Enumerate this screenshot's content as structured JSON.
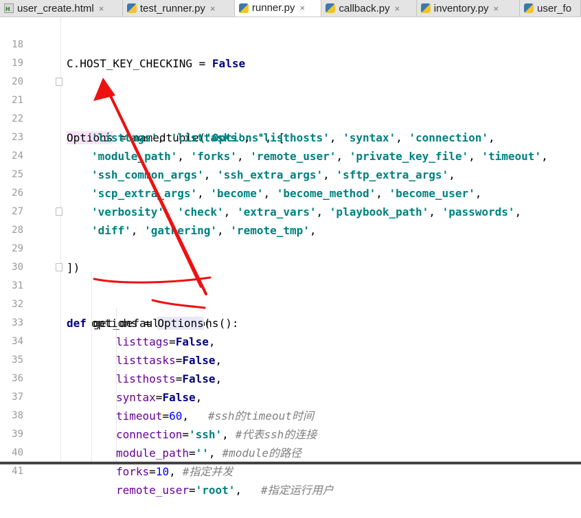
{
  "tabs": [
    {
      "label": "user_create.html",
      "icon": "html-file-icon",
      "active": false
    },
    {
      "label": "test_runner.py",
      "icon": "python-file-icon",
      "active": false
    },
    {
      "label": "runner.py",
      "icon": "python-file-icon",
      "active": true
    },
    {
      "label": "callback.py",
      "icon": "python-file-icon",
      "active": false
    },
    {
      "label": "inventory.py",
      "icon": "python-file-icon",
      "active": false
    },
    {
      "label": "user_fo",
      "icon": "python-file-icon",
      "active": false
    }
  ],
  "close_glyph": "×",
  "lines": [
    {
      "n": "18"
    },
    {
      "n": "19"
    },
    {
      "n": "20"
    },
    {
      "n": "21"
    },
    {
      "n": "22"
    },
    {
      "n": "23"
    },
    {
      "n": "24"
    },
    {
      "n": "25"
    },
    {
      "n": "26"
    },
    {
      "n": "27"
    },
    {
      "n": "28"
    },
    {
      "n": "29"
    },
    {
      "n": "30"
    },
    {
      "n": "31"
    },
    {
      "n": "32"
    },
    {
      "n": "33"
    },
    {
      "n": "34"
    },
    {
      "n": "35"
    },
    {
      "n": "36"
    },
    {
      "n": "37"
    },
    {
      "n": "38"
    },
    {
      "n": "39"
    },
    {
      "n": "40"
    },
    {
      "n": "41"
    }
  ],
  "code": {
    "l18": "C.HOST_KEY_CHECKING = ",
    "false": "False",
    "options": "Options",
    "nt_eq": " = namedtuple(",
    "nt_name": "'Options'",
    "nt_open": ", [",
    "l22": [
      "'listtags'",
      "'listtasks'",
      "'listhosts'",
      "'syntax'",
      "'connection'"
    ],
    "l23": [
      "'module_path'",
      "'forks'",
      "'remote_user'",
      "'private_key_file'",
      "'timeout'"
    ],
    "l24": [
      "'ssh_common_args'",
      "'ssh_extra_args'",
      "'sftp_extra_args'"
    ],
    "l25": [
      "'scp_extra_args'",
      "'become'",
      "'become_method'",
      "'become_user'"
    ],
    "l26": [
      "'verbosity'",
      "'check'",
      "'extra_vars'",
      "'playbook_path'",
      "'passwords'"
    ],
    "l27": [
      "'diff'",
      "'gathering'",
      "'remote_tmp'"
    ],
    "sep": ", ",
    "l28": "])",
    "def": "def",
    "fn": " get_default_options():",
    "opts_assign": "options = ",
    "paren": "(",
    "p_listtags": "listtags",
    "p_listtasks": "listtasks",
    "p_listhosts": "listhosts",
    "p_syntax": "syntax",
    "p_timeout": "timeout",
    "p_connection": "connection",
    "p_module_path": "module_path",
    "p_forks": "forks",
    "p_remote_user": "remote_user",
    "eq": "=",
    "comma": ",",
    "v_60": "60",
    "v_10": "10",
    "v_ssh": "'ssh'",
    "v_empty": "''",
    "v_root": "'root'",
    "c_timeout": "#ssh的timeout时间",
    "c_conn": "#代表ssh的连接",
    "c_module": "#module的路径",
    "c_forks": "#指定并发",
    "c_user": "#指定运行用户"
  },
  "annotation_color": "#ee1111"
}
